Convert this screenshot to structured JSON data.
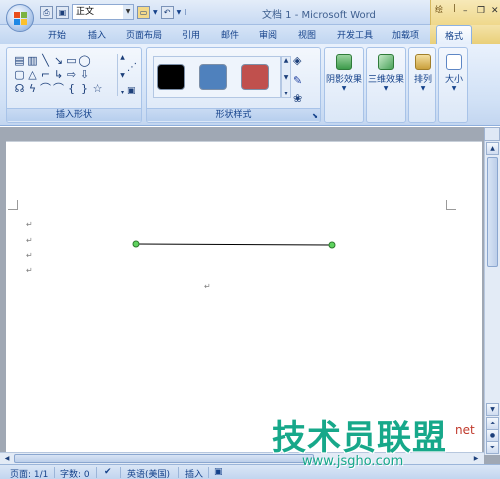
{
  "window": {
    "title": "文档 1 - Microsoft Word",
    "context_tab_group": "绘"
  },
  "quick_access": {
    "style_value": "正文"
  },
  "tabs": [
    {
      "label": "开始"
    },
    {
      "label": "插入"
    },
    {
      "label": "页面布局"
    },
    {
      "label": "引用"
    },
    {
      "label": "邮件"
    },
    {
      "label": "审阅"
    },
    {
      "label": "视图"
    },
    {
      "label": "开发工具"
    },
    {
      "label": "加载项"
    },
    {
      "label": "格式",
      "active": true
    }
  ],
  "ribbon": {
    "insert_shapes_group": "插入形状",
    "shape_styles_group": "形状样式",
    "style_swatches": [
      "#000000",
      "#4f81bd",
      "#c0504d"
    ],
    "buttons": [
      {
        "label": "阴影效果",
        "icon": "shadow-effects-icon",
        "color": "#3d9b4b"
      },
      {
        "label": "三维效果",
        "icon": "3d-effects-icon",
        "color": "#4aa35a"
      },
      {
        "label": "排列",
        "icon": "arrange-icon",
        "color": "#c9a03c"
      },
      {
        "label": "大小",
        "icon": "size-icon",
        "color": "#5d86c5"
      }
    ]
  },
  "document": {
    "paragraph_mark": "↵"
  },
  "statusbar": {
    "page": "页面: 1/1",
    "words": "字数: 0",
    "language": "英语(美国)",
    "mode": "插入"
  },
  "watermark": {
    "main": "技术员联盟",
    "url": "www.jsgho.com",
    "net": "net"
  },
  "colors": {
    "accent": "#15428b",
    "context_tab": "#f4e3a8",
    "line_handle": "#34a853"
  }
}
